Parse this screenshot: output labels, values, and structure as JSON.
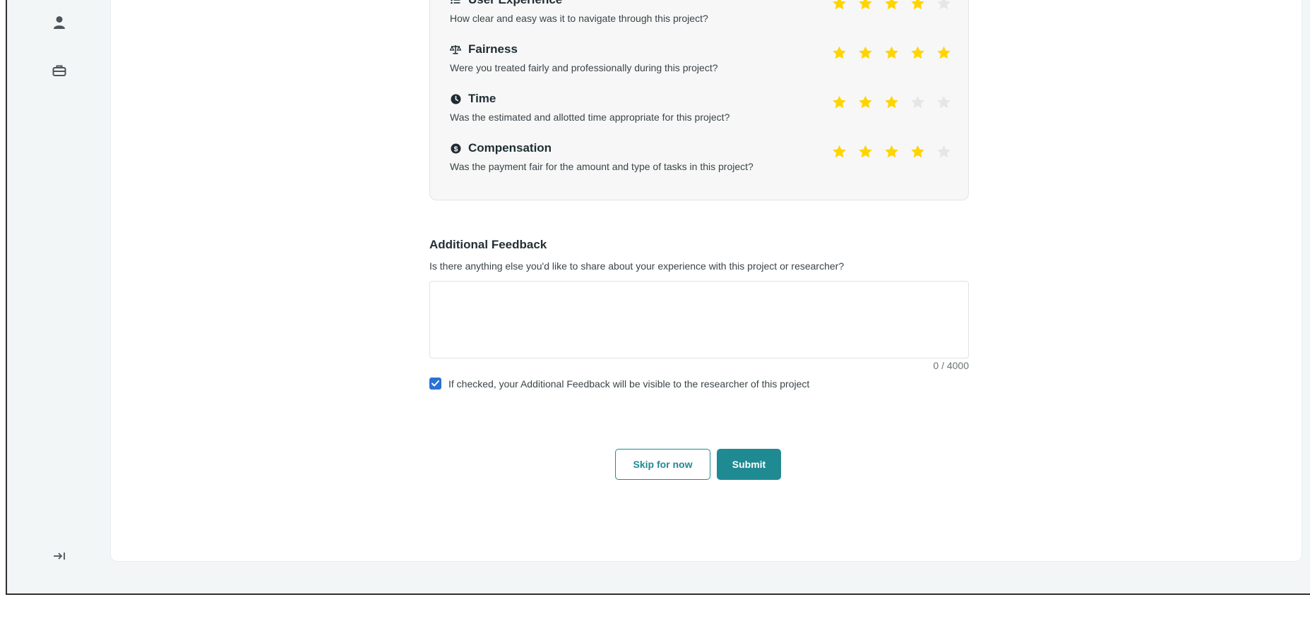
{
  "sidebar": {
    "icons": [
      {
        "name": "user-icon"
      },
      {
        "name": "toolbox-icon"
      },
      {
        "name": "expand-sidebar-icon"
      }
    ]
  },
  "ratings": [
    {
      "icon": "list-icon",
      "title": "User Experience",
      "description": "How clear and easy was it to navigate through this project?",
      "stars": 4,
      "max": 5
    },
    {
      "icon": "scale-icon",
      "title": "Fairness",
      "description": "Were you treated fairly and professionally during this project?",
      "stars": 5,
      "max": 5
    },
    {
      "icon": "clock-icon",
      "title": "Time",
      "description": "Was the estimated and allotted time appropriate for this project?",
      "stars": 3,
      "max": 5
    },
    {
      "icon": "dollar-icon",
      "title": "Compensation",
      "description": "Was the payment fair for the amount and type of tasks in this project?",
      "stars": 4,
      "max": 5
    }
  ],
  "feedback": {
    "heading": "Additional Feedback",
    "subtitle": "Is there anything else you'd like to share about your experience with this project or researcher?",
    "value": "",
    "counter": "0 / 4000",
    "checkbox_checked": true,
    "checkbox_label": "If checked, your Additional Feedback will be visible to the researcher of this project"
  },
  "actions": {
    "skip_label": "Skip for now",
    "submit_label": "Submit"
  },
  "colors": {
    "star_on": "#ffd400",
    "star_off": "#e6e6e6",
    "accent": "#1f8a92",
    "checkbox": "#2a72d4"
  }
}
